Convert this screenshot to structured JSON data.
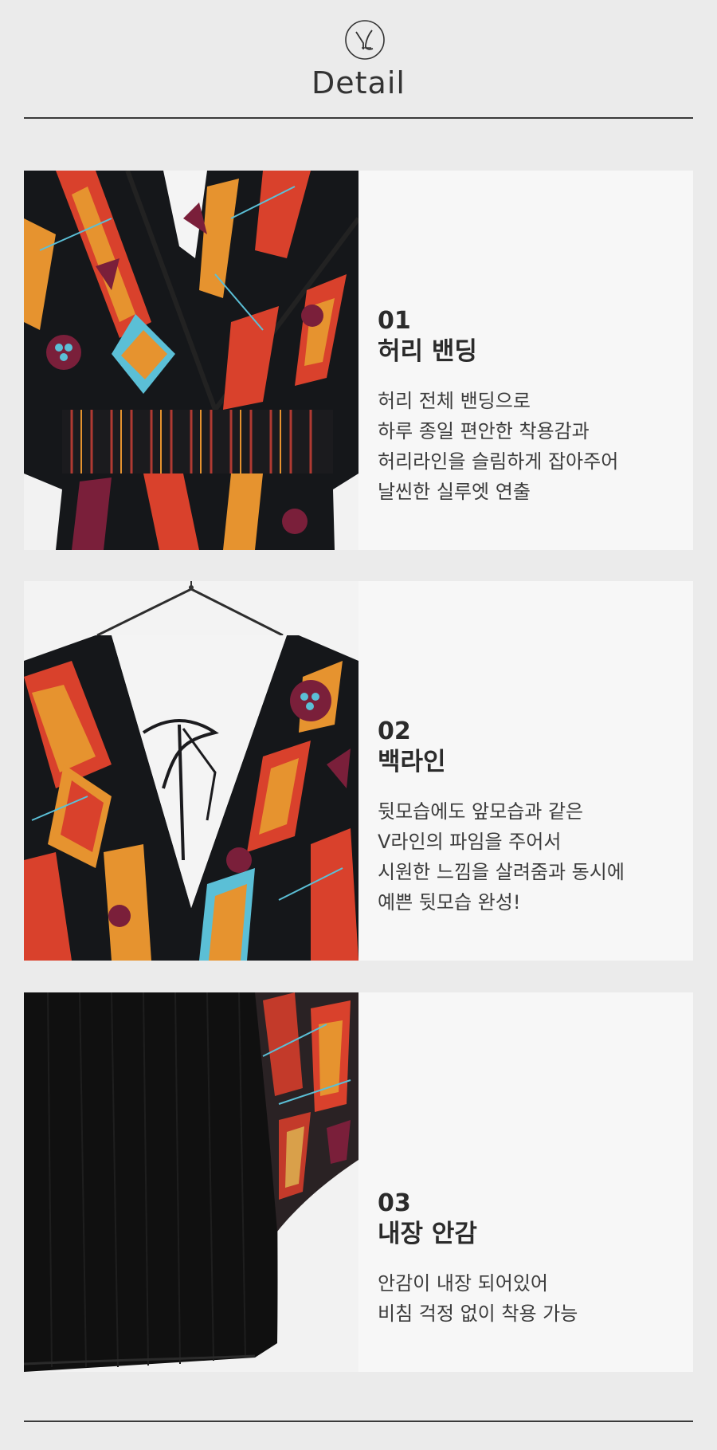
{
  "header": {
    "logo_name": "brand-monogram-logo",
    "title": "Detail"
  },
  "features": [
    {
      "number": "01",
      "title": "허리 밴딩",
      "lines": [
        "허리 전체 밴딩으로",
        "하루 종일 편안한 착용감과",
        "허리라인을 슬림하게 잡아주어",
        "날씬한 실루엣 연출"
      ]
    },
    {
      "number": "02",
      "title": "백라인",
      "lines": [
        "뒷모습에도 앞모습과 같은",
        "V라인의 파임을 주어서",
        "시원한 느낌을 살려줌과 동시에",
        "예쁜 뒷모습 완성!"
      ]
    },
    {
      "number": "03",
      "title": "내장 안감",
      "lines": [
        "안감이 내장 되어있어",
        "비침 걱정 없이 착용 가능"
      ]
    }
  ],
  "colors": {
    "background": "#ebebeb",
    "card": "#f7f7f7",
    "text": "#2b2b2b",
    "fabric_black": "#15171a",
    "print_red": "#d9412c",
    "print_orange": "#e6932f",
    "print_maroon": "#7a1f3a",
    "print_cyan": "#5bbfd6"
  }
}
